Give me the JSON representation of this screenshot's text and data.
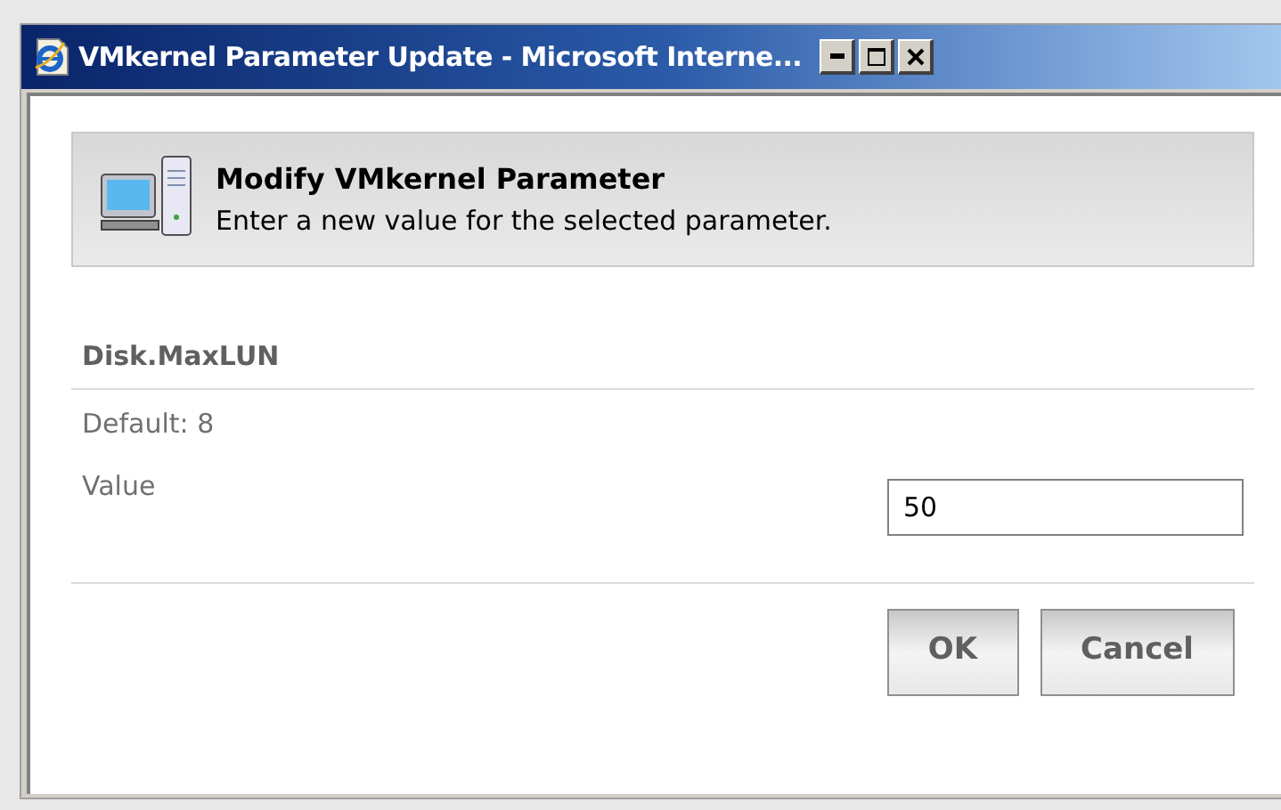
{
  "window": {
    "title": "VMkernel Parameter Update - Microsoft Interne..."
  },
  "header": {
    "title": "Modify VMkernel Parameter",
    "subtitle": "Enter a new value for the selected parameter."
  },
  "parameter": {
    "name": "Disk.MaxLUN",
    "default": "Default: 8",
    "label": "Value",
    "value": "50"
  },
  "buttons": [
    "OK",
    "Cancel"
  ]
}
